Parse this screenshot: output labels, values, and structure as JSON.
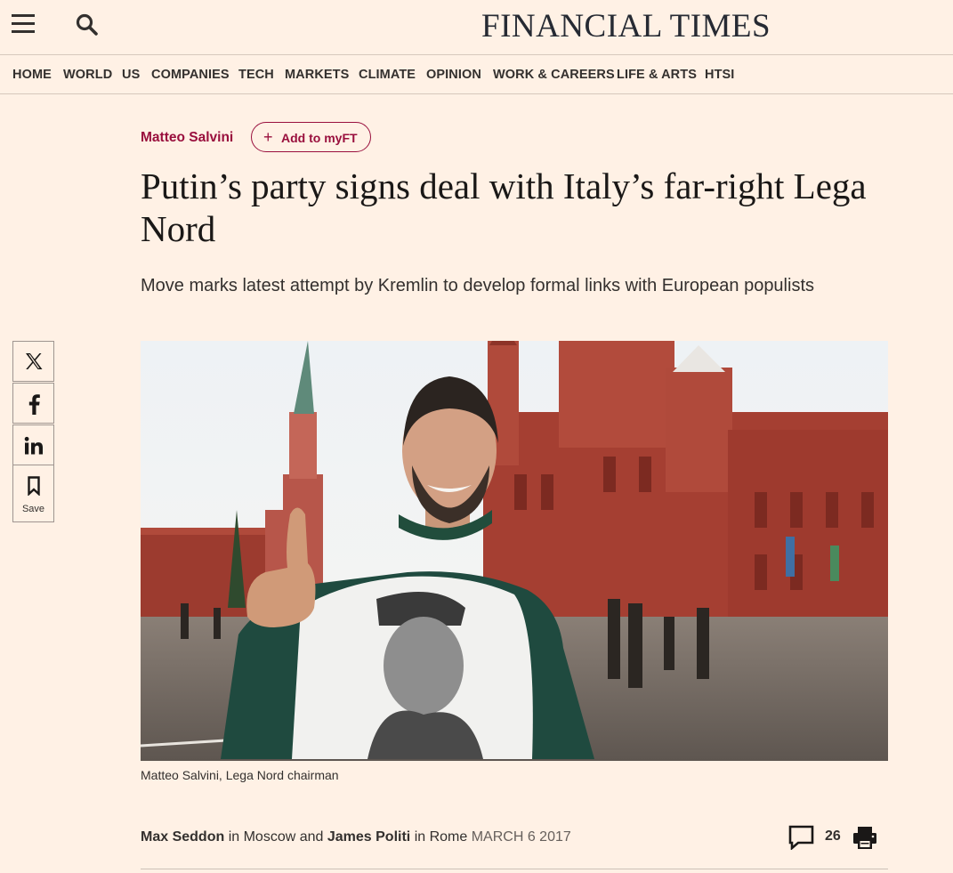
{
  "header": {
    "masthead": "FINANCIAL TIMES",
    "menu_icon": "hamburger-menu-icon",
    "search_icon": "search-icon"
  },
  "nav": {
    "items": [
      {
        "label": "HOME"
      },
      {
        "label": "WORLD"
      },
      {
        "label": "US"
      },
      {
        "label": "COMPANIES"
      },
      {
        "label": "TECH"
      },
      {
        "label": "MARKETS"
      },
      {
        "label": "CLIMATE"
      },
      {
        "label": "OPINION"
      },
      {
        "label": "WORK & CAREERS"
      },
      {
        "label": "LIFE & ARTS"
      },
      {
        "label": "HTSI"
      }
    ]
  },
  "article": {
    "topic": "Matteo Salvini",
    "follow_label": "Add to myFT",
    "follow_icon": "plus-icon",
    "headline": "Putin’s party signs deal with Italy’s far-right Lega Nord",
    "standfirst": "Move marks latest attempt by Kremlin to develop formal links with European populists",
    "caption": "Matteo Salvini, Lega Nord chairman",
    "byline": {
      "author1": "Max Seddon",
      "in1": "in Moscow and",
      "author2": "James Politi",
      "in2": "in Rome",
      "date": "MARCH 6 2017"
    },
    "comment_count": "26",
    "comment_icon": "comment-icon",
    "print_icon": "print-icon"
  },
  "share": {
    "items": [
      {
        "icon": "x-icon"
      },
      {
        "icon": "facebook-icon"
      },
      {
        "icon": "linkedin-icon"
      },
      {
        "icon": "bookmark-icon",
        "label": "Save"
      }
    ]
  },
  "colors": {
    "background": "#fff1e5",
    "accent": "#990f3d",
    "text": "#33302e"
  }
}
